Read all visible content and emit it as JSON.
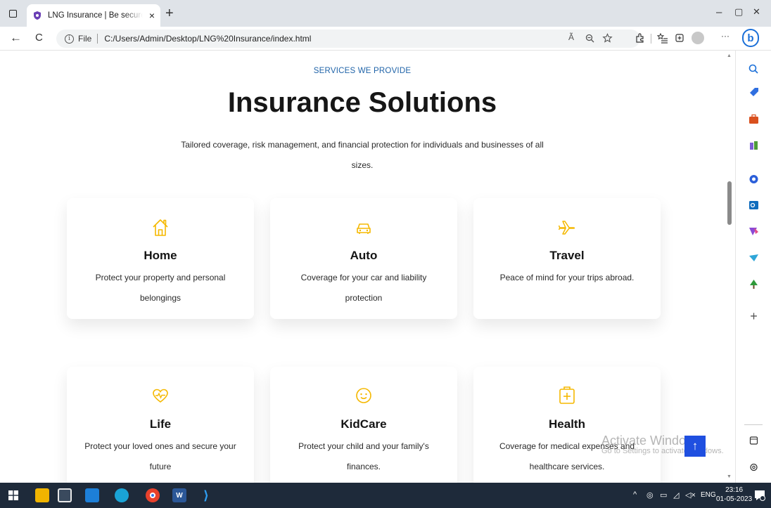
{
  "browser": {
    "tab_title": "LNG Insurance | Be secured for fu",
    "close_glyph": "×",
    "new_tab_glyph": "+",
    "address_scheme": "File",
    "address_url": "C:/Users/Admin/Desktop/LNG%20Insurance/index.html",
    "read_aloud_glyph": "Ã",
    "win_minimize": "–",
    "win_restore": "▢",
    "win_close": "✕",
    "back_glyph": "←",
    "refresh_glyph": "C",
    "more_glyph": "···",
    "bing_glyph": "b"
  },
  "section": {
    "eyebrow": "SERVICES WE PROVIDE",
    "headline": "Insurance Solutions",
    "subtitle": "Tailored coverage, risk management, and financial protection for individuals and businesses of all sizes."
  },
  "cards": [
    {
      "icon": "house-icon",
      "title": "Home",
      "desc": "Protect your property and personal belongings"
    },
    {
      "icon": "car-icon",
      "title": "Auto",
      "desc": "Coverage for your car and liability protection"
    },
    {
      "icon": "airplane-icon",
      "title": "Travel",
      "desc": "Peace of mind for your trips abroad."
    },
    {
      "icon": "heart-pulse-icon",
      "title": "Life",
      "desc": "Protect your loved ones and secure your future"
    },
    {
      "icon": "smiley-icon",
      "title": "KidCare",
      "desc": "Protect your child and your family's finances."
    },
    {
      "icon": "medical-case-icon",
      "title": "Health",
      "desc": "Coverage for medical expenses and healthcare services."
    }
  ],
  "overlay": {
    "activate_title": "Activate Windows",
    "activate_sub": "Go to Settings to activate Windows.",
    "scroll_top_glyph": "↑"
  },
  "taskbar": {
    "language": "ENG",
    "time": "23:16",
    "date": "01-05-2023"
  },
  "colors": {
    "accent_icon": "#f5b800",
    "eyebrow": "#1f63a8",
    "scroll_top_button": "#1f4fe0",
    "taskbar": "#1e2a3a"
  }
}
